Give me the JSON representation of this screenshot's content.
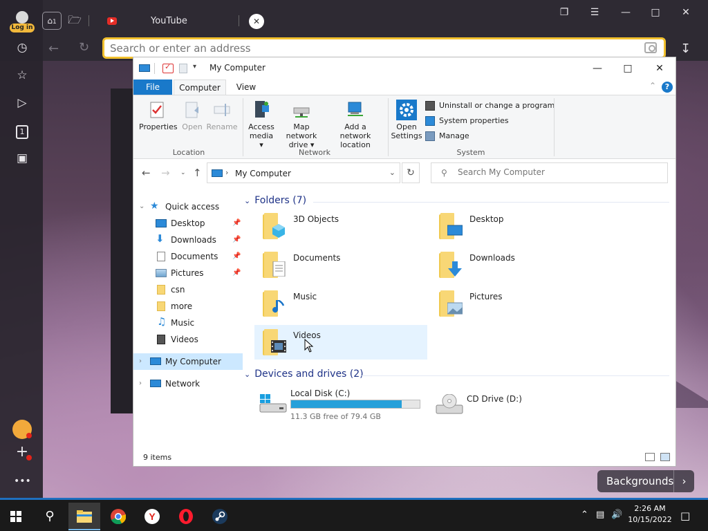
{
  "browser": {
    "login_label": "Log in",
    "tab_title": "YouTube",
    "address_placeholder": "Search or enter an address",
    "backgrounds_label": "Backgrounds",
    "home_tab_number": "1"
  },
  "explorer": {
    "window_title": "My Computer",
    "ribbon_tabs": [
      "File",
      "Computer",
      "View"
    ],
    "ribbon": {
      "location": {
        "label": "Location",
        "buttons": [
          "Properties",
          "Open",
          "Rename"
        ]
      },
      "network": {
        "label": "Network",
        "buttons": [
          {
            "line1": "Access",
            "line2": "media ▾"
          },
          {
            "line1": "Map network",
            "line2": "drive ▾"
          },
          {
            "line1": "Add a network",
            "line2": "location"
          }
        ]
      },
      "system": {
        "label": "System",
        "open_settings": {
          "line1": "Open",
          "line2": "Settings"
        },
        "small_buttons": [
          "Uninstall or change a program",
          "System properties",
          "Manage"
        ]
      }
    },
    "path": "My Computer",
    "search_placeholder": "Search My Computer",
    "nav_pane": {
      "quick_access": "Quick access",
      "items": [
        "Desktop",
        "Downloads",
        "Documents",
        "Pictures",
        "csn",
        "more",
        "Music",
        "Videos"
      ],
      "my_computer": "My Computer",
      "network": "Network"
    },
    "folders_header": "Folders (7)",
    "folders": [
      "3D Objects",
      "Desktop",
      "Documents",
      "Downloads",
      "Music",
      "Pictures",
      "Videos"
    ],
    "devices_header": "Devices and drives (2)",
    "drives": [
      {
        "name": "Local Disk (C:)",
        "free": "11.3 GB free of 79.4 GB",
        "used_fraction": 0.86
      },
      {
        "name": "CD Drive (D:)"
      }
    ],
    "status": "9 items"
  },
  "taskbar": {
    "time": "2:26 AM",
    "date": "10/15/2022"
  }
}
